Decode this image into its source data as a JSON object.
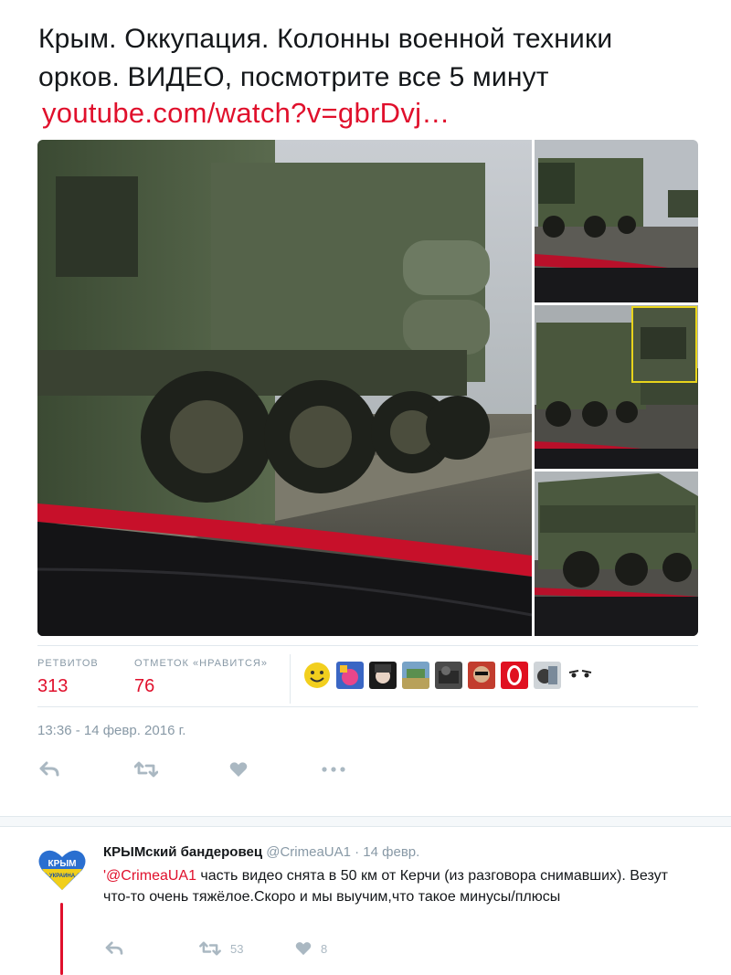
{
  "tweet": {
    "text_line1": "Крым. Оккупация. Колонны военной техники",
    "text_line2": "орков. ВИДЕО, посмотрите все 5 минут",
    "link": "youtube.com/watch?v=gbrDvj…"
  },
  "stats": {
    "retweets_label": "РЕТВИТОВ",
    "retweets_value": "313",
    "likes_label": "ОТМЕТОК «НРАВИТСЯ»",
    "likes_value": "76"
  },
  "timestamp": "13:36 - 14 февр. 2016 г.",
  "reply": {
    "name": "КРЫМский бандеровец",
    "handle": "@CrimeaUA1",
    "date": " · 14 февр.",
    "avatar_text_1": "КРЫМ",
    "avatar_text_2": "УКРАИНА",
    "mention": "'@CrimeaUA1",
    "body": " часть видео снята в 50 км от Керчи (из разговора снимавших). Везут что-то очень тяжёлое.Скоро и мы выучим,что такое минусы/плюсы",
    "retweet_count": "53",
    "like_count": "8"
  },
  "colors": {
    "accent": "#e0102c",
    "muted": "#8899a6",
    "icon": "#aab8c2"
  },
  "icons": [
    "reply-icon",
    "retweet-icon",
    "heart-icon",
    "more-icon"
  ]
}
